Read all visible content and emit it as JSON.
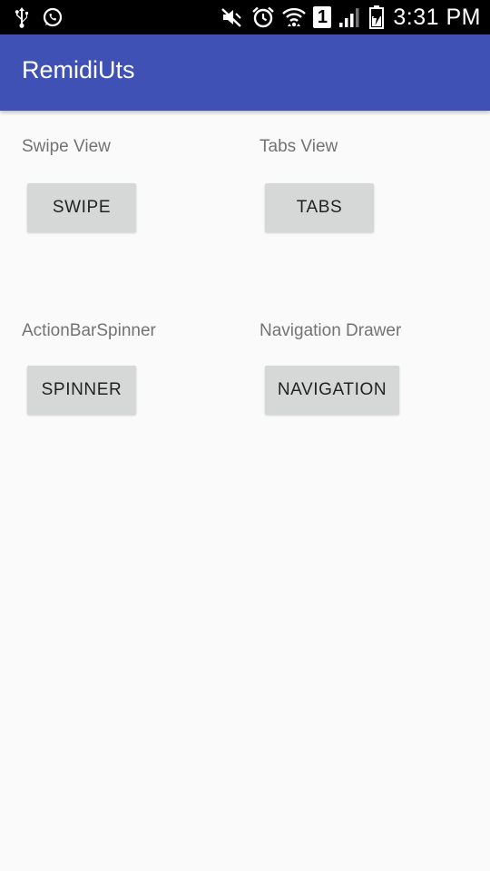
{
  "status_bar": {
    "time": "3:31 PM",
    "sim_slot": "1",
    "icons": [
      "usb-icon",
      "whatsapp-icon",
      "mute-icon",
      "alarm-icon",
      "wifi-icon",
      "sim-1-icon",
      "signal-icon",
      "battery-charging-icon"
    ]
  },
  "app_bar": {
    "title": "RemidiUts",
    "color": "#3f51b5"
  },
  "sections": {
    "swipe": {
      "label": "Swipe View",
      "button": "SWIPE"
    },
    "tabs": {
      "label": "Tabs View",
      "button": "TABS"
    },
    "spinner": {
      "label": "ActionBarSpinner",
      "button": "SPINNER"
    },
    "navigation": {
      "label": "Navigation Drawer",
      "button": "NAVIGATION"
    }
  }
}
